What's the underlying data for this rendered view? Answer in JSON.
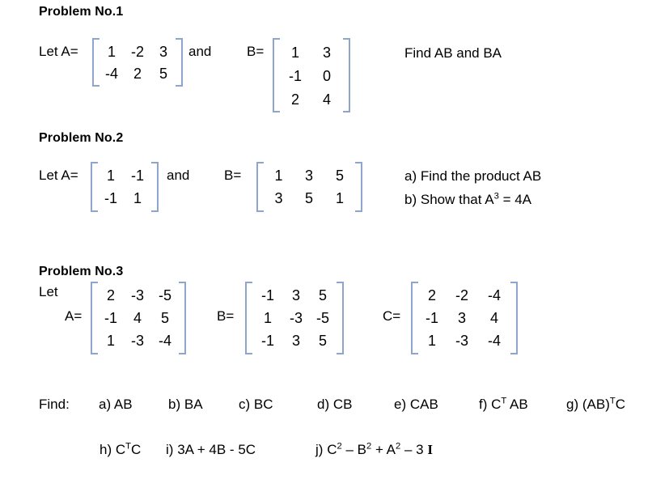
{
  "document": {
    "title": "Matrix Problems Worksheet"
  },
  "problem1": {
    "heading": "Problem No.1",
    "let_label": "Let A=",
    "and_label": "and",
    "b_label": "B=",
    "matrixA": {
      "rows": 2,
      "cols": 3,
      "values": [
        [
          "1",
          "-2",
          "3"
        ],
        [
          "-4",
          "2",
          "5"
        ]
      ]
    },
    "matrixB": {
      "rows": 3,
      "cols": 2,
      "values": [
        [
          "1",
          "3"
        ],
        [
          "-1",
          "0"
        ],
        [
          "2",
          "4"
        ]
      ]
    },
    "task": "Find  AB  and  BA"
  },
  "problem2": {
    "heading": "Problem No.2",
    "let_label": "Let A=",
    "and_label": "and",
    "b_label": "B=",
    "matrixA": {
      "rows": 2,
      "cols": 2,
      "values": [
        [
          "1",
          "-1"
        ],
        [
          "-1",
          "1"
        ]
      ]
    },
    "matrixB": {
      "rows": 2,
      "cols": 3,
      "values": [
        [
          "1",
          "3",
          "5"
        ],
        [
          "3",
          "5",
          "1"
        ]
      ]
    },
    "tasks": [
      {
        "marker": "a)",
        "text": "Find the product AB"
      },
      {
        "marker": "b)",
        "text_pre": "Show that A",
        "sup": "3",
        "text_post": " = 4A"
      }
    ]
  },
  "problem3": {
    "heading": "Problem No.3",
    "let_label": "Let",
    "a_label": "A=",
    "b_label": "B=",
    "c_label": "C=",
    "matrixA": {
      "rows": 3,
      "cols": 3,
      "values": [
        [
          "2",
          "-3",
          "-5"
        ],
        [
          "-1",
          "4",
          "5"
        ],
        [
          "1",
          "-3",
          "-4"
        ]
      ]
    },
    "matrixB": {
      "rows": 3,
      "cols": 3,
      "values": [
        [
          "-1",
          "3",
          "5"
        ],
        [
          "1",
          "-3",
          "-5"
        ],
        [
          "-1",
          "3",
          "5"
        ]
      ]
    },
    "matrixC": {
      "rows": 3,
      "cols": 3,
      "values": [
        [
          "2",
          "-2",
          "-4"
        ],
        [
          "-1",
          "3",
          "4"
        ],
        [
          "1",
          "-3",
          "-4"
        ]
      ]
    },
    "find_label": "Find:",
    "items_row1": [
      {
        "marker": "a)",
        "expr": "AB"
      },
      {
        "marker": "b)",
        "expr": "BA"
      },
      {
        "marker": "c)",
        "expr": "BC"
      },
      {
        "marker": "d)",
        "expr": "CB"
      },
      {
        "marker": "e)",
        "expr": "CAB"
      },
      {
        "marker": "f)",
        "expr": "CT AB"
      },
      {
        "marker": "g)",
        "expr": "(AB)TC"
      }
    ],
    "item_f": {
      "marker": "f)",
      "base": "C",
      "sup": "T",
      "rest": " AB"
    },
    "item_g": {
      "marker": "g)",
      "base": "(AB)",
      "sup": "T",
      "rest": "C"
    },
    "item_h": {
      "marker": "h)",
      "base": "C",
      "sup": "T",
      "rest": "C"
    },
    "item_i": {
      "marker": "i)",
      "expr": "3A + 4B - 5C"
    },
    "item_j": {
      "marker": "j)",
      "p1": "C",
      "s1": "2",
      "p2": " – B",
      "s2": "2",
      "p3": " + A",
      "s3": "2",
      "p4": " – 3 ",
      "identity": "I"
    }
  },
  "colors": {
    "bracket": "#8ea6cd",
    "text": "#000000",
    "background": "#ffffff"
  }
}
